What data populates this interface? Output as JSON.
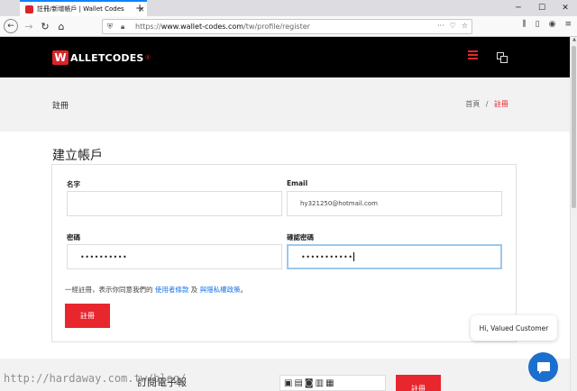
{
  "browser": {
    "tab_title": "註冊/新增帳戶 | Wallet Codes",
    "url_host": "www.wallet-codes.com",
    "url_path": "/tw/profile/register",
    "url_scheme": "https://"
  },
  "site": {
    "logo_w": "W",
    "logo_text": "ALLETCODES",
    "logo_reg": "®"
  },
  "breadcrumb": {
    "page": "註冊",
    "home": "首頁",
    "separator": "/",
    "current": "註冊"
  },
  "form": {
    "title": "建立帳戶",
    "name_label": "名字",
    "name_value": "",
    "email_label": "Email",
    "email_value": "hy321250@hotmail.com",
    "password_label": "密碼",
    "password_value": "••••••••••",
    "confirm_label": "確認密碼",
    "confirm_value": "•••••••••••",
    "terms_prefix": "一經註冊，表示你同意我們的",
    "terms_link": "使用者條款",
    "terms_and": "及",
    "privacy_link": "與隱私權政策",
    "terms_suffix": "。",
    "submit_label": "註冊"
  },
  "footer": {
    "text": "訂閱電子報",
    "button_label": "註冊"
  },
  "chat": {
    "greeting": "Hi, Valued Customer"
  },
  "watermark": "http://hardaway.com.tw/blog/",
  "colors": {
    "accent": "#e8262e",
    "link": "#1a73e8",
    "chat": "#1b6fce"
  }
}
